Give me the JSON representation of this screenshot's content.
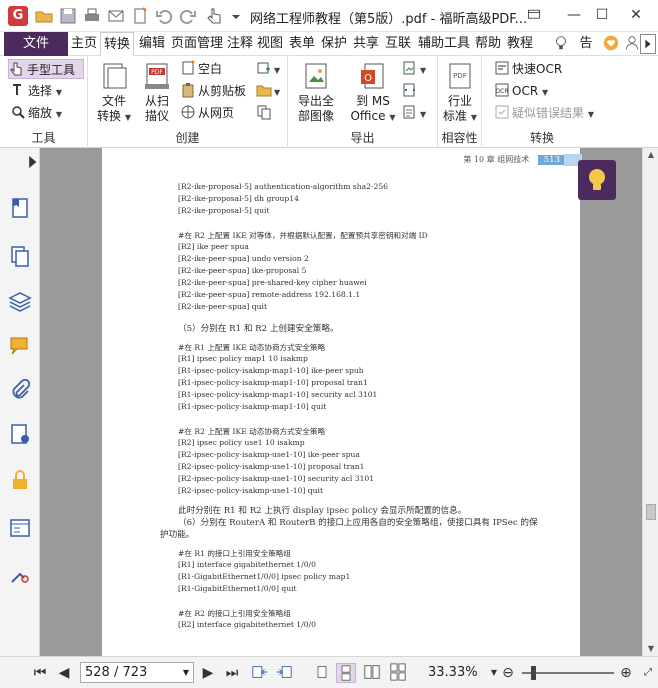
{
  "window": {
    "title": "网络工程师教程（第5版）.pdf - 福昕高级PDF...",
    "app_logo_letter": "G"
  },
  "menu": {
    "file": "文件",
    "items": [
      "主页",
      "转换",
      "编辑",
      "页面管理",
      "注释",
      "视图",
      "表单",
      "保护",
      "共享",
      "互联",
      "辅助工具",
      "帮助",
      "教程"
    ],
    "active": "转换",
    "tell_me": "告诉"
  },
  "ribbon": {
    "tools": {
      "label": "工具",
      "hand": "手型工具",
      "select": "选择",
      "zoom": "缩放"
    },
    "create": {
      "label": "创建",
      "file_convert": [
        "文件",
        "转换"
      ],
      "from_scanner": [
        "从扫",
        "描仪"
      ],
      "blank": "空白",
      "from_clipboard": "从剪贴板",
      "from_web": "从网页"
    },
    "export": {
      "label": "导出",
      "export_images": [
        "导出全",
        "部图像"
      ],
      "to_ms_office": [
        "到 MS",
        "Office"
      ]
    },
    "compat": {
      "label": "相容性",
      "industry_standard": [
        "行业",
        "标准"
      ]
    },
    "convert": {
      "label": "转换",
      "quick_ocr": "快速OCR",
      "ocr": "OCR",
      "suspect_results": "疑似错误结果"
    }
  },
  "document": {
    "header_text": "第 10 章  组网技术",
    "page_number": "513",
    "lines": [
      "[R2-ike-proposal-5] authentication-algorithm sha2-256",
      "[R2-ike-proposal-5] dh group14",
      "[R2-ike-proposal-5] quit",
      "#在 R2 上配置 IKE 对等体，并根据默认配置，配置预共享密钥和对端 ID",
      "[R2] ike peer spua",
      "[R2-ike-peer-spua] undo version 2",
      "[R2-ike-peer-spua] ike-proposal 5",
      "[R2-ike-peer-spua] pre-shared-key cipher huawei",
      "[R2-ike-peer-spua] remote-address 192.168.1.1",
      "[R2-ike-peer-spua] quit",
      "（5）分别在 R1 和 R2 上创建安全策略。",
      "#在 R1 上配置 IKE 动态协商方式安全策略",
      "[R1] ipsec policy map1 10 isakmp",
      "[R1-ipsec-policy-isakmp-map1-10] ike-peer spub",
      "[R1-ipsec-policy-isakmp-map1-10] proposal tran1",
      "[R1-ipsec-policy-isakmp-map1-10] security acl 3101",
      "[R1-ipsec-policy-isakmp-map1-10] quit",
      "#在 R2 上配置 IKE 动态协商方式安全策略",
      "[R2] ipsec policy use1 10 isakmp",
      "[R2-ipsec-policy-isakmp-use1-10] ike-peer spua",
      "[R2-ipsec-policy-isakmp-use1-10] proposal tran1",
      "[R2-ipsec-policy-isakmp-use1-10] security acl 3101",
      "[R2-ipsec-policy-isakmp-use1-10] quit",
      "此时分别在 R1 和 R2 上执行 display ipsec policy 会显示所配置的信息。",
      "（6）分别在 RouterA 和 RouterB 的接口上应用各自的安全策略组，使接口具有 IPSec 的保",
      "护功能。",
      "#在 R1 的接口上引用安全策略组",
      "[R1] interface gigabitethernet 1/0/0",
      "[R1-GigabitEthernet1/0/0] ipsec policy map1",
      "[R1-GigabitEthernet1/0/0] quit",
      "#在 R2 的接口上引用安全策略组",
      "[R2] interface gigabitethernet 1/0/0"
    ]
  },
  "status": {
    "page_field": "528 / 723",
    "zoom": "33.33%",
    "zoom_level": 0.33
  },
  "colors": {
    "accent": "#4d2a5e",
    "page_tab": "#6fa7d6"
  }
}
